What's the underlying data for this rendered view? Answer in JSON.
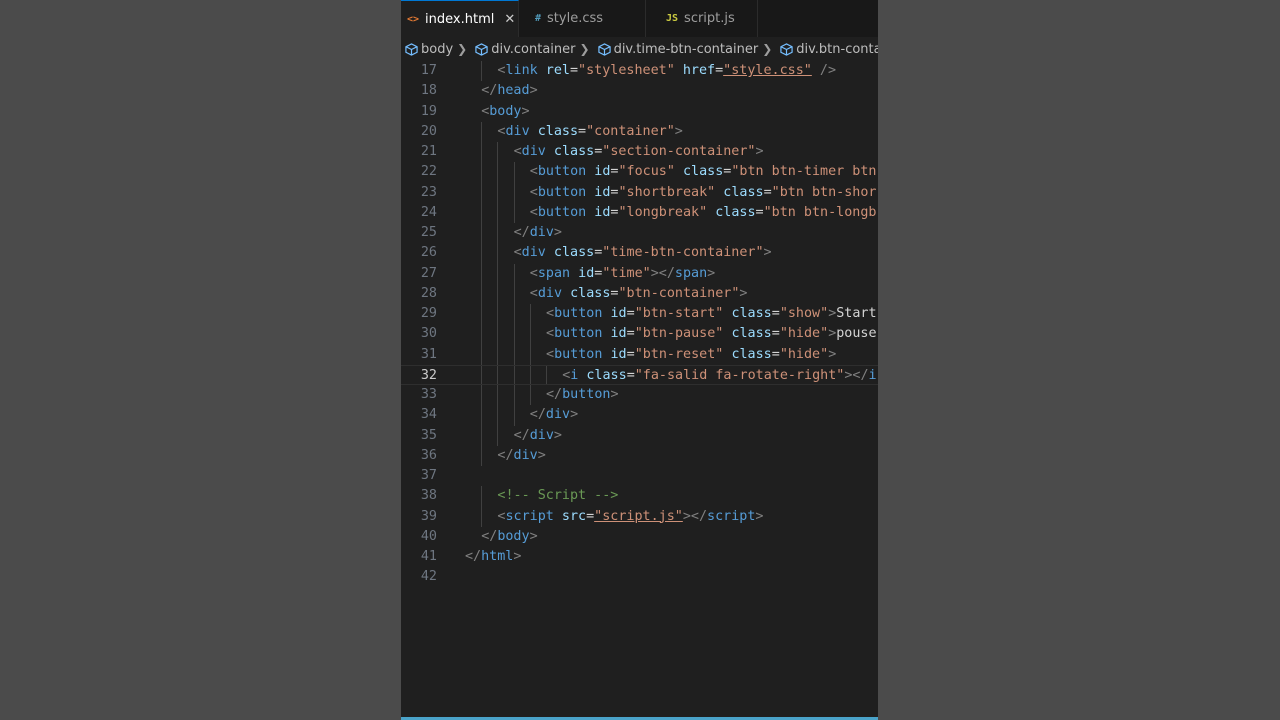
{
  "tabs": [
    {
      "icon": "<>",
      "label": "index.html",
      "active": true,
      "icon_color": "#e37933"
    },
    {
      "icon": "#",
      "label": "style.css",
      "active": false,
      "icon_color": "#519aba"
    },
    {
      "icon": "JS",
      "label": "script.js",
      "active": false,
      "icon_color": "#cbcb41"
    }
  ],
  "breadcrumbs": [
    "body",
    "div.container",
    "div.time-btn-container",
    "div.btn-container"
  ],
  "code": {
    "current_line": 32,
    "lines": [
      {
        "n": 17,
        "indent": 2,
        "tokens": [
          [
            "p",
            "<"
          ],
          [
            "t",
            "link"
          ],
          [
            "x",
            " "
          ],
          [
            "a",
            "rel"
          ],
          [
            "x",
            "="
          ],
          [
            "s",
            "\"stylesheet\""
          ],
          [
            "x",
            " "
          ],
          [
            "a",
            "href"
          ],
          [
            "x",
            "="
          ],
          [
            "su",
            "\"style.css\""
          ],
          [
            "x",
            " "
          ],
          [
            "p",
            "/>"
          ]
        ]
      },
      {
        "n": 18,
        "indent": 1,
        "tokens": [
          [
            "p",
            "</"
          ],
          [
            "t",
            "head"
          ],
          [
            "p",
            ">"
          ]
        ]
      },
      {
        "n": 19,
        "indent": 1,
        "tokens": [
          [
            "p",
            "<"
          ],
          [
            "t",
            "body"
          ],
          [
            "p",
            ">"
          ]
        ]
      },
      {
        "n": 20,
        "indent": 2,
        "tokens": [
          [
            "p",
            "<"
          ],
          [
            "t",
            "div"
          ],
          [
            "x",
            " "
          ],
          [
            "a",
            "class"
          ],
          [
            "x",
            "="
          ],
          [
            "s",
            "\"container\""
          ],
          [
            "p",
            ">"
          ]
        ]
      },
      {
        "n": 21,
        "indent": 3,
        "tokens": [
          [
            "p",
            "<"
          ],
          [
            "t",
            "div"
          ],
          [
            "x",
            " "
          ],
          [
            "a",
            "class"
          ],
          [
            "x",
            "="
          ],
          [
            "s",
            "\"section-container\""
          ],
          [
            "p",
            ">"
          ]
        ]
      },
      {
        "n": 22,
        "indent": 4,
        "tokens": [
          [
            "p",
            "<"
          ],
          [
            "t",
            "button"
          ],
          [
            "x",
            " "
          ],
          [
            "a",
            "id"
          ],
          [
            "x",
            "="
          ],
          [
            "s",
            "\"focus\""
          ],
          [
            "x",
            " "
          ],
          [
            "a",
            "class"
          ],
          [
            "x",
            "="
          ],
          [
            "s",
            "\"btn btn-timer btn"
          ]
        ]
      },
      {
        "n": 23,
        "indent": 4,
        "tokens": [
          [
            "p",
            "<"
          ],
          [
            "t",
            "button"
          ],
          [
            "x",
            " "
          ],
          [
            "a",
            "id"
          ],
          [
            "x",
            "="
          ],
          [
            "s",
            "\"shortbreak\""
          ],
          [
            "x",
            " "
          ],
          [
            "a",
            "class"
          ],
          [
            "x",
            "="
          ],
          [
            "s",
            "\"btn btn-shor"
          ]
        ]
      },
      {
        "n": 24,
        "indent": 4,
        "tokens": [
          [
            "p",
            "<"
          ],
          [
            "t",
            "button"
          ],
          [
            "x",
            " "
          ],
          [
            "a",
            "id"
          ],
          [
            "x",
            "="
          ],
          [
            "s",
            "\"longbreak\""
          ],
          [
            "x",
            " "
          ],
          [
            "a",
            "class"
          ],
          [
            "x",
            "="
          ],
          [
            "s",
            "\"btn btn-longb"
          ]
        ]
      },
      {
        "n": 25,
        "indent": 3,
        "tokens": [
          [
            "p",
            "</"
          ],
          [
            "t",
            "div"
          ],
          [
            "p",
            ">"
          ]
        ]
      },
      {
        "n": 26,
        "indent": 3,
        "tokens": [
          [
            "p",
            "<"
          ],
          [
            "t",
            "div"
          ],
          [
            "x",
            " "
          ],
          [
            "a",
            "class"
          ],
          [
            "x",
            "="
          ],
          [
            "s",
            "\"time-btn-container\""
          ],
          [
            "p",
            ">"
          ]
        ]
      },
      {
        "n": 27,
        "indent": 4,
        "tokens": [
          [
            "p",
            "<"
          ],
          [
            "t",
            "span"
          ],
          [
            "x",
            " "
          ],
          [
            "a",
            "id"
          ],
          [
            "x",
            "="
          ],
          [
            "s",
            "\"time\""
          ],
          [
            "p",
            "></"
          ],
          [
            "t",
            "span"
          ],
          [
            "p",
            ">"
          ]
        ]
      },
      {
        "n": 28,
        "indent": 4,
        "tokens": [
          [
            "p",
            "<"
          ],
          [
            "t",
            "div"
          ],
          [
            "x",
            " "
          ],
          [
            "a",
            "class"
          ],
          [
            "x",
            "="
          ],
          [
            "s",
            "\"btn-container\""
          ],
          [
            "p",
            ">"
          ]
        ]
      },
      {
        "n": 29,
        "indent": 5,
        "tokens": [
          [
            "p",
            "<"
          ],
          [
            "t",
            "button"
          ],
          [
            "x",
            " "
          ],
          [
            "a",
            "id"
          ],
          [
            "x",
            "="
          ],
          [
            "s",
            "\"btn-start\""
          ],
          [
            "x",
            " "
          ],
          [
            "a",
            "class"
          ],
          [
            "x",
            "="
          ],
          [
            "s",
            "\"show\""
          ],
          [
            "p",
            ">"
          ],
          [
            "x",
            "Start"
          ]
        ]
      },
      {
        "n": 30,
        "indent": 5,
        "tokens": [
          [
            "p",
            "<"
          ],
          [
            "t",
            "button"
          ],
          [
            "x",
            " "
          ],
          [
            "a",
            "id"
          ],
          [
            "x",
            "="
          ],
          [
            "s",
            "\"btn-pause\""
          ],
          [
            "x",
            " "
          ],
          [
            "a",
            "class"
          ],
          [
            "x",
            "="
          ],
          [
            "s",
            "\"hide\""
          ],
          [
            "p",
            ">"
          ],
          [
            "x",
            "pouse"
          ]
        ]
      },
      {
        "n": 31,
        "indent": 5,
        "tokens": [
          [
            "p",
            "<"
          ],
          [
            "t",
            "button"
          ],
          [
            "x",
            " "
          ],
          [
            "a",
            "id"
          ],
          [
            "x",
            "="
          ],
          [
            "s",
            "\"btn-reset\""
          ],
          [
            "x",
            " "
          ],
          [
            "a",
            "class"
          ],
          [
            "x",
            "="
          ],
          [
            "s",
            "\"hide\""
          ],
          [
            "p",
            ">"
          ]
        ]
      },
      {
        "n": 32,
        "indent": 6,
        "tokens": [
          [
            "p",
            "<"
          ],
          [
            "t",
            "i"
          ],
          [
            "x",
            " "
          ],
          [
            "a",
            "class"
          ],
          [
            "x",
            "="
          ],
          [
            "s",
            "\"fa-salid fa-rotate-right\""
          ],
          [
            "p",
            "></"
          ],
          [
            "t",
            "i"
          ]
        ]
      },
      {
        "n": 33,
        "indent": 5,
        "tokens": [
          [
            "p",
            "</"
          ],
          [
            "t",
            "button"
          ],
          [
            "p",
            ">"
          ]
        ]
      },
      {
        "n": 34,
        "indent": 4,
        "tokens": [
          [
            "p",
            "</"
          ],
          [
            "t",
            "div"
          ],
          [
            "p",
            ">"
          ]
        ]
      },
      {
        "n": 35,
        "indent": 3,
        "tokens": [
          [
            "p",
            "</"
          ],
          [
            "t",
            "div"
          ],
          [
            "p",
            ">"
          ]
        ]
      },
      {
        "n": 36,
        "indent": 2,
        "tokens": [
          [
            "p",
            "</"
          ],
          [
            "t",
            "div"
          ],
          [
            "p",
            ">"
          ]
        ]
      },
      {
        "n": 37,
        "indent": 0,
        "tokens": []
      },
      {
        "n": 38,
        "indent": 2,
        "tokens": [
          [
            "c",
            "<!-- Script -->"
          ]
        ]
      },
      {
        "n": 39,
        "indent": 2,
        "tokens": [
          [
            "p",
            "<"
          ],
          [
            "t",
            "script"
          ],
          [
            "x",
            " "
          ],
          [
            "a",
            "src"
          ],
          [
            "x",
            "="
          ],
          [
            "su",
            "\"script.js\""
          ],
          [
            "p",
            "></"
          ],
          [
            "t",
            "script"
          ],
          [
            "p",
            ">"
          ]
        ]
      },
      {
        "n": 40,
        "indent": 1,
        "tokens": [
          [
            "p",
            "</"
          ],
          [
            "t",
            "body"
          ],
          [
            "p",
            ">"
          ]
        ]
      },
      {
        "n": 41,
        "indent": 0,
        "tokens": [
          [
            "p",
            "</"
          ],
          [
            "t",
            "html"
          ],
          [
            "p",
            ">"
          ]
        ]
      },
      {
        "n": 42,
        "indent": 0,
        "tokens": []
      }
    ]
  }
}
